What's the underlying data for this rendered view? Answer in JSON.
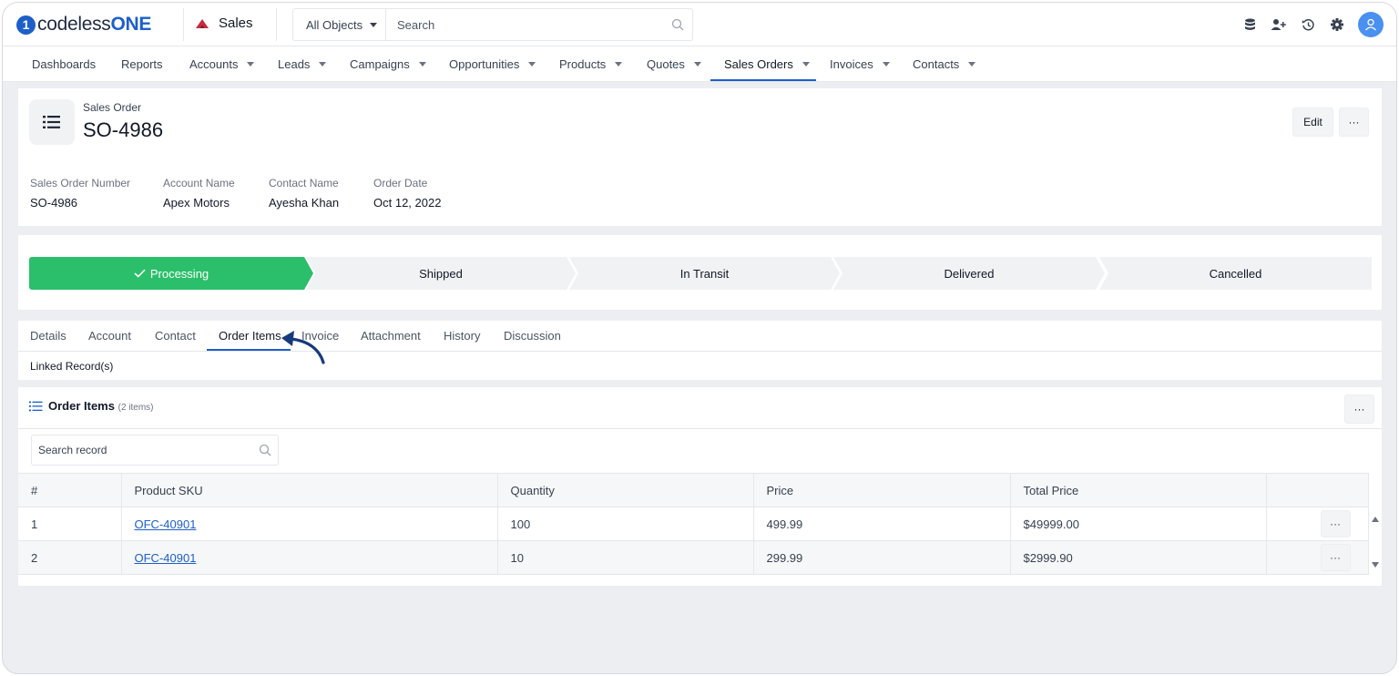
{
  "brand": {
    "name_prefix": "codeless",
    "name_suffix": "ONE",
    "mark": "1"
  },
  "app": {
    "name": "Sales"
  },
  "search": {
    "object_filter": "All Objects",
    "placeholder": "Search"
  },
  "nav": {
    "items": [
      {
        "label": "Dashboards",
        "dropdown": false
      },
      {
        "label": "Reports",
        "dropdown": false
      },
      {
        "label": "Accounts",
        "dropdown": true
      },
      {
        "label": "Leads",
        "dropdown": true
      },
      {
        "label": "Campaigns",
        "dropdown": true
      },
      {
        "label": "Opportunities",
        "dropdown": true
      },
      {
        "label": "Products",
        "dropdown": true
      },
      {
        "label": "Quotes",
        "dropdown": true
      },
      {
        "label": "Sales Orders",
        "dropdown": true,
        "active": true
      },
      {
        "label": "Invoices",
        "dropdown": true
      },
      {
        "label": "Contacts",
        "dropdown": true
      }
    ]
  },
  "record": {
    "type": "Sales Order",
    "title": "SO-4986",
    "edit_label": "Edit",
    "more_label": "···",
    "fields": [
      {
        "label": "Sales Order Number",
        "value": "SO-4986"
      },
      {
        "label": "Account Name",
        "value": "Apex Motors"
      },
      {
        "label": "Contact Name",
        "value": "Ayesha Khan"
      },
      {
        "label": "Order Date",
        "value": "Oct 12, 2022"
      }
    ]
  },
  "stages": [
    {
      "label": "Processing",
      "completed": true
    },
    {
      "label": "Shipped",
      "completed": false
    },
    {
      "label": "In Transit",
      "completed": false
    },
    {
      "label": "Delivered",
      "completed": false
    },
    {
      "label": "Cancelled",
      "completed": false
    }
  ],
  "tabs": {
    "items": [
      "Details",
      "Account",
      "Contact",
      "Order Items",
      "Invoice",
      "Attachment",
      "History",
      "Discussion"
    ],
    "active": "Order Items",
    "subheader": "Linked Record(s)"
  },
  "order_items": {
    "title": "Order Items",
    "count_label": "(2 items)",
    "search_placeholder": "Search record",
    "more_label": "···",
    "columns": [
      "#",
      "Product SKU",
      "Quantity",
      "Price",
      "Total Price"
    ],
    "rows": [
      {
        "index": "1",
        "sku": "OFC-40901",
        "quantity": "100",
        "price": "499.99",
        "total": "$49999.00",
        "more": "···"
      },
      {
        "index": "2",
        "sku": "OFC-40901",
        "quantity": "10",
        "price": "299.99",
        "total": "$2999.90",
        "more": "···"
      }
    ]
  },
  "colors": {
    "accent": "#1d5fc9",
    "stage_done": "#2cbf6b",
    "avatar": "#4a90f0"
  },
  "icons": [
    "database-icon",
    "add-user-icon",
    "history-icon",
    "settings-icon",
    "user-avatar-icon",
    "list-icon",
    "arrow-annotation-icon"
  ]
}
